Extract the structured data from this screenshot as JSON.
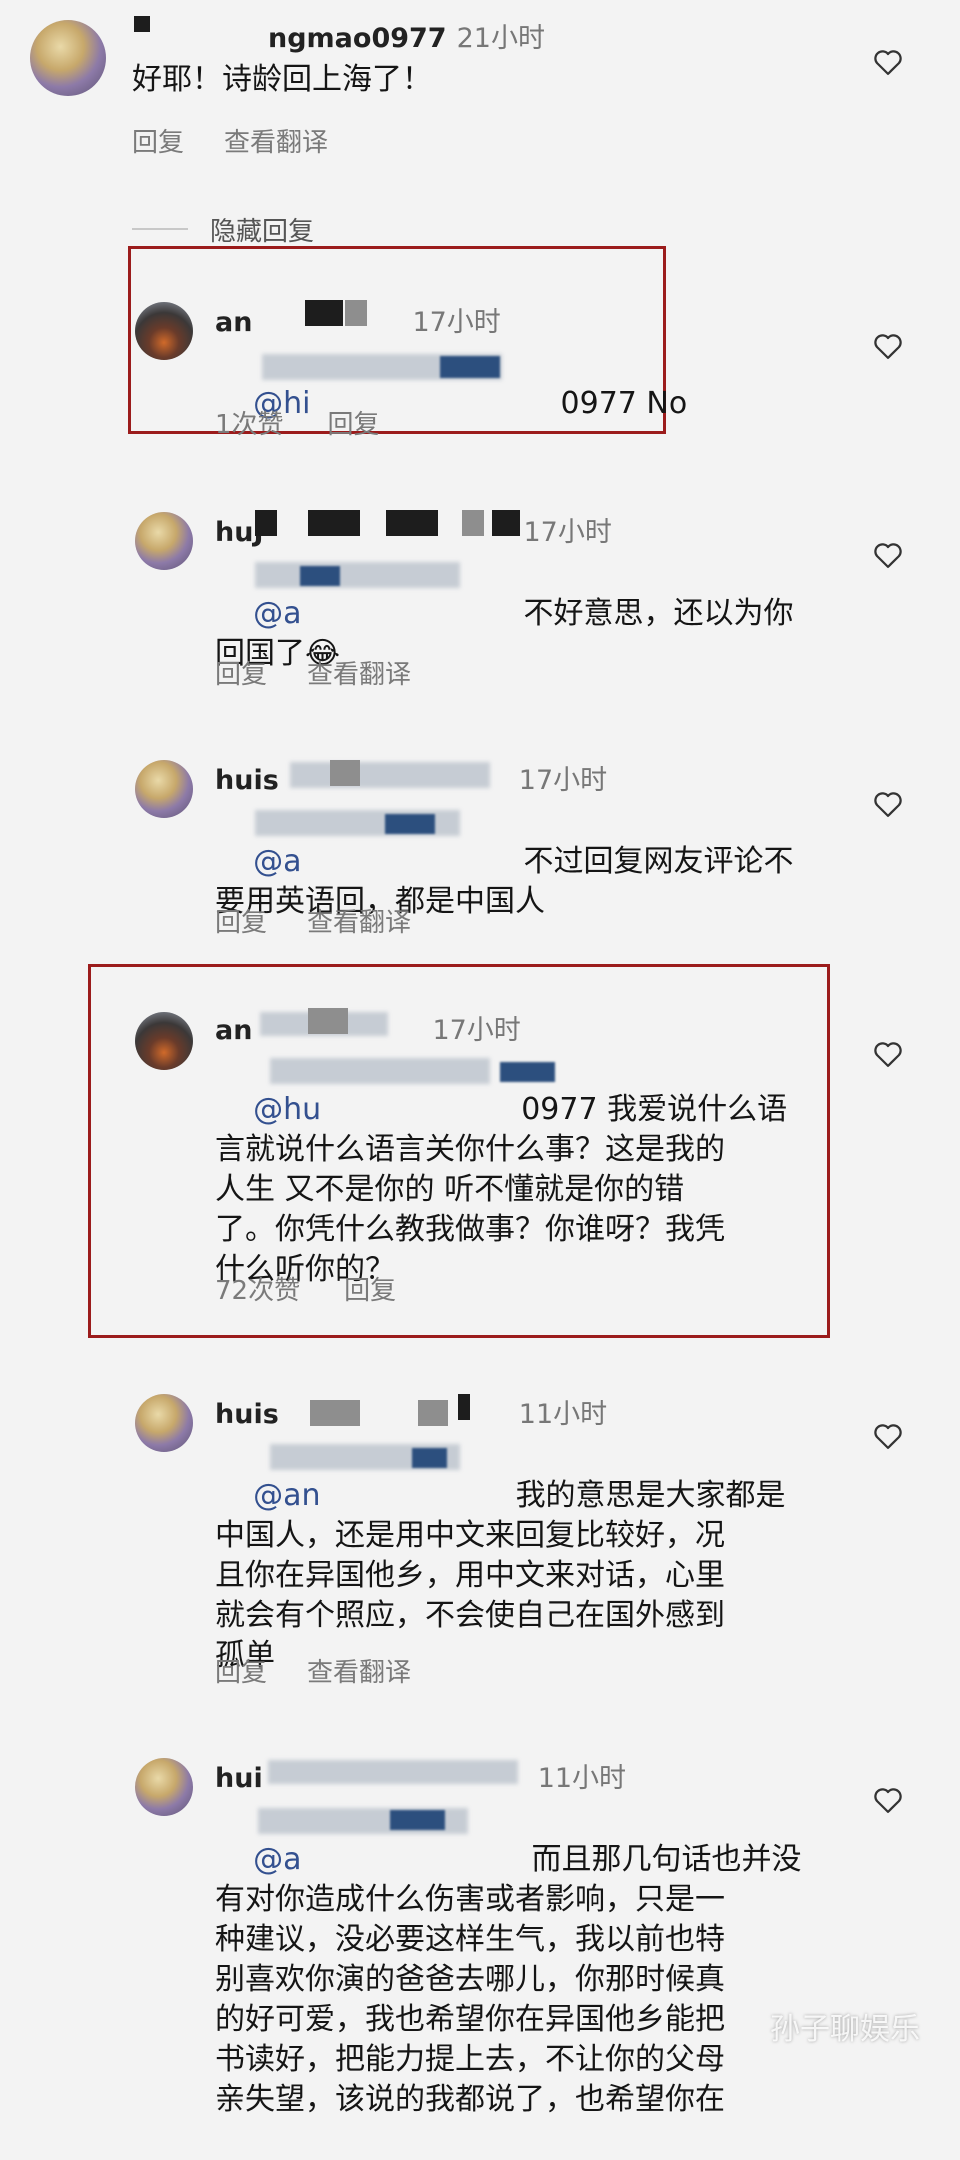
{
  "comments": [
    {
      "username": "ngmao0977",
      "time": "21小时",
      "mention": "",
      "text": "好耶！诗龄回上海了！",
      "likes": "",
      "reply": "回复",
      "translate": "查看翻译"
    },
    {
      "username": "an",
      "time": "17小时",
      "mention": "@hi",
      "text": "0977 No",
      "likes": "1次赞",
      "reply": "回复",
      "translate": ""
    },
    {
      "username": "huJ",
      "time": "17小时",
      "mention": "@a",
      "text": "不好意思，还以为你\n回国了😂",
      "likes": "",
      "reply": "回复",
      "translate": "查看翻译"
    },
    {
      "username": "huis",
      "time": "17小时",
      "mention": "@a",
      "text": "不过回复网友评论不\n要用英语回，都是中国人",
      "likes": "",
      "reply": "回复",
      "translate": "查看翻译"
    },
    {
      "username": "an",
      "time": "17小时",
      "mention": "@hu",
      "text": "0977 我爱说什么语\n言就说什么语言关你什么事？这是我的\n人生 又不是你的 听不懂就是你的错\n了。你凭什么教我做事？你谁呀？我凭\n什么听你的？",
      "likes": "72次赞",
      "reply": "回复",
      "translate": ""
    },
    {
      "username": "huis",
      "time": "11小时",
      "mention": "@an",
      "text": "我的意思是大家都是\n中国人，还是用中文来回复比较好，况\n且你在异国他乡，用中文来对话，心里\n就会有个照应，不会使自己在国外感到\n孤单",
      "likes": "",
      "reply": "回复",
      "translate": "查看翻译"
    },
    {
      "username": "hui",
      "time": "11小时",
      "mention": "@a",
      "text": "而且那几句话也并没\n有对你造成什么伤害或者影响，只是一\n种建议，没必要这样生气，我以前也特\n别喜欢你演的爸爸去哪儿，你那时候真\n的好可爱，我也希望你在异国他乡能把\n书读好，把能力提上去，不让你的父母\n亲失望，该说的我都说了，也希望你在",
      "likes": "",
      "reply": "",
      "translate": ""
    }
  ],
  "hidden_replies_label": "隐藏回复",
  "watermark": "孙子聊娱乐",
  "icons": {
    "like": "heart-icon"
  },
  "colors": {
    "highlight_box": "#9b1b1b",
    "mention": "#33508f"
  }
}
